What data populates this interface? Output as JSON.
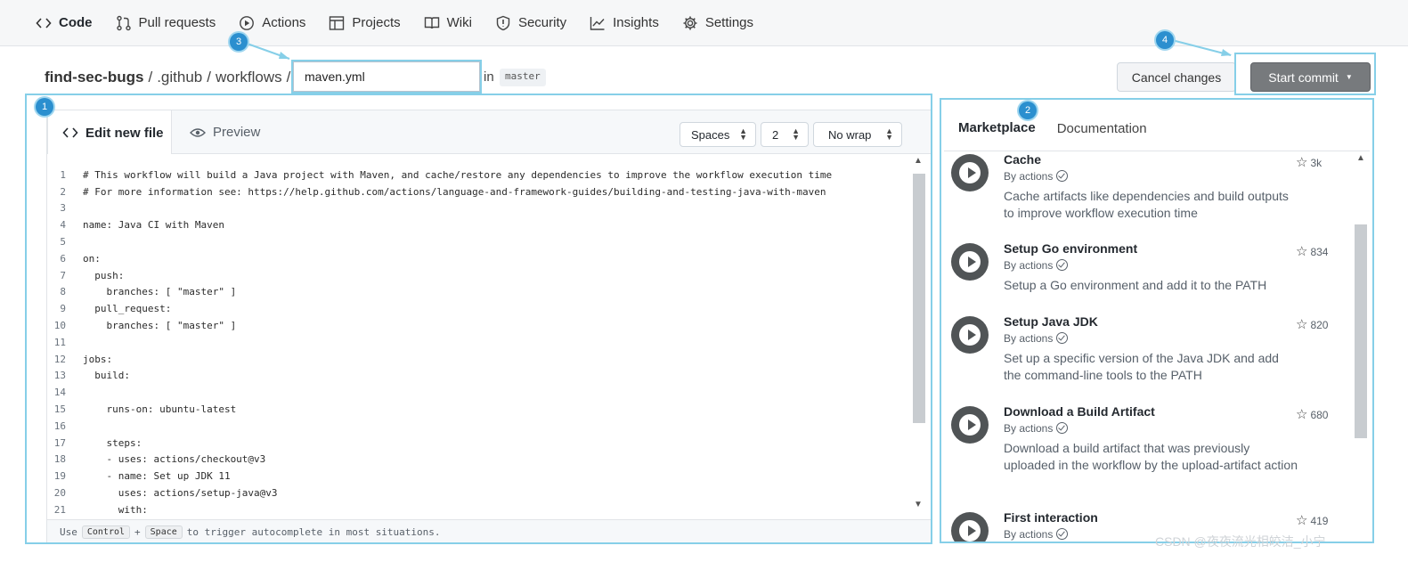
{
  "nav": {
    "tabs": [
      {
        "label": "Code",
        "icon": "code-icon"
      },
      {
        "label": "Pull requests",
        "icon": "pull-request-icon"
      },
      {
        "label": "Actions",
        "icon": "play-icon"
      },
      {
        "label": "Projects",
        "icon": "table-icon"
      },
      {
        "label": "Wiki",
        "icon": "book-icon"
      },
      {
        "label": "Security",
        "icon": "shield-icon"
      },
      {
        "label": "Insights",
        "icon": "graph-icon"
      },
      {
        "label": "Settings",
        "icon": "gear-icon"
      }
    ]
  },
  "breadcrumb": {
    "repo": "find-sec-bugs",
    "sep": "/",
    "dir1": ".github",
    "dir2": "workflows",
    "filename": "maven.yml",
    "in": "in",
    "branch": "master"
  },
  "actions": {
    "cancel": "Cancel changes",
    "commit": "Start commit"
  },
  "annotations": [
    "1",
    "2",
    "3",
    "4"
  ],
  "editor": {
    "tab_edit": "Edit new file",
    "tab_preview": "Preview",
    "indent_mode": "Spaces",
    "indent_size": "2",
    "wrap_mode": "No wrap",
    "lines": [
      {
        "n": "1",
        "text": "# This workflow will build a Java project with Maven, and cache/restore any dependencies to improve the workflow execution time"
      },
      {
        "n": "2",
        "text": "# For more information see: https://help.github.com/actions/language-and-framework-guides/building-and-testing-java-with-maven"
      },
      {
        "n": "3",
        "text": ""
      },
      {
        "n": "4",
        "text": "name: Java CI with Maven"
      },
      {
        "n": "5",
        "text": ""
      },
      {
        "n": "6",
        "text": "on:"
      },
      {
        "n": "7",
        "text": "  push:"
      },
      {
        "n": "8",
        "text": "    branches: [ \"master\" ]"
      },
      {
        "n": "9",
        "text": "  pull_request:"
      },
      {
        "n": "10",
        "text": "    branches: [ \"master\" ]"
      },
      {
        "n": "11",
        "text": ""
      },
      {
        "n": "12",
        "text": "jobs:"
      },
      {
        "n": "13",
        "text": "  build:"
      },
      {
        "n": "14",
        "text": ""
      },
      {
        "n": "15",
        "text": "    runs-on: ubuntu-latest"
      },
      {
        "n": "16",
        "text": ""
      },
      {
        "n": "17",
        "text": "    steps:"
      },
      {
        "n": "18",
        "text": "    - uses: actions/checkout@v3"
      },
      {
        "n": "19",
        "text": "    - name: Set up JDK 11"
      },
      {
        "n": "20",
        "text": "      uses: actions/setup-java@v3"
      },
      {
        "n": "21",
        "text": "      with:"
      }
    ],
    "hint": {
      "pre": "Use",
      "key1": "Control",
      "plus": "+",
      "key2": "Space",
      "post": "to trigger autocomplete in most situations."
    }
  },
  "sidebar": {
    "tab_marketplace": "Marketplace",
    "tab_docs": "Documentation",
    "items": [
      {
        "title": "Cache",
        "by": "By actions",
        "desc": "Cache artifacts like dependencies and build outputs to improve workflow execution time",
        "stars": "3k"
      },
      {
        "title": "Setup Go environment",
        "by": "By actions",
        "desc": "Setup a Go environment and add it to the PATH",
        "stars": "834"
      },
      {
        "title": "Setup Java JDK",
        "by": "By actions",
        "desc": "Set up a specific version of the Java JDK and add the command-line tools to the PATH",
        "stars": "820"
      },
      {
        "title": "Download a Build Artifact",
        "by": "By actions",
        "desc": "Download a build artifact that was previously uploaded in the workflow by the upload-artifact action",
        "stars": "680"
      },
      {
        "title": "First interaction",
        "by": "By actions",
        "desc": "",
        "stars": "419"
      }
    ]
  },
  "watermark": "CSDN @夜夜流光相皎洁_小宁",
  "colors": {
    "highlight": "#86cfe8",
    "badge": "#2b8fcf",
    "commit_button": "#777a7d"
  }
}
